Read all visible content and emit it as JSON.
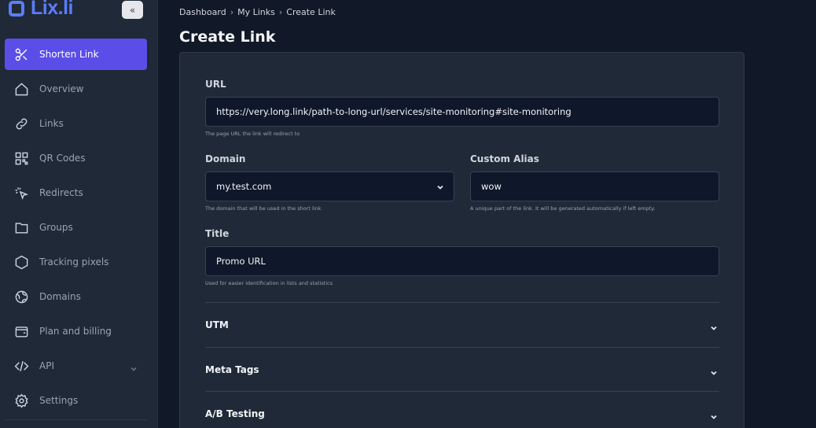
{
  "brand": {
    "name": "Lix.li"
  },
  "sidebar": {
    "collapse_label": "«",
    "items": [
      {
        "label": "Shorten Link",
        "icon": "scissors-icon",
        "active": true
      },
      {
        "label": "Overview",
        "icon": "home-icon"
      },
      {
        "label": "Links",
        "icon": "link-icon"
      },
      {
        "label": "QR Codes",
        "icon": "qr-code-icon"
      },
      {
        "label": "Redirects",
        "icon": "cursor-click-icon"
      },
      {
        "label": "Groups",
        "icon": "folder-icon"
      },
      {
        "label": "Tracking pixels",
        "icon": "hexagon-icon"
      },
      {
        "label": "Domains",
        "icon": "globe-icon"
      },
      {
        "label": "Plan and billing",
        "icon": "wallet-icon"
      },
      {
        "label": "API",
        "icon": "code-icon",
        "has_submenu": true
      },
      {
        "label": "Settings",
        "icon": "gear-icon"
      }
    ]
  },
  "breadcrumb": [
    "Dashboard",
    "My Links",
    "Create Link"
  ],
  "breadcrumb_separator": "›",
  "page": {
    "title": "Create Link"
  },
  "form": {
    "url": {
      "label": "URL",
      "value": "https://very.long.link/path-to-long-url/services/site-monitoring#site-monitoring",
      "hint": "The page URL the link will redirect to"
    },
    "domain": {
      "label": "Domain",
      "value": "my.test.com",
      "hint": "The domain that will be used in the short link"
    },
    "alias": {
      "label": "Custom Alias",
      "value": "wow",
      "hint": "A unique part of the link. It will be generated automatically if left empty."
    },
    "title": {
      "label": "Title",
      "value": "Promo URL",
      "hint": "Used for easier identification in lists and statistics"
    },
    "sections": [
      {
        "label": "UTM"
      },
      {
        "label": "Meta Tags"
      },
      {
        "label": "A/B Testing"
      }
    ]
  },
  "colors": {
    "background": "#111827",
    "sidebar": "#1f2937",
    "accent": "#5b4de8",
    "brand": "#5b7cfa",
    "input": "#0f172a"
  }
}
